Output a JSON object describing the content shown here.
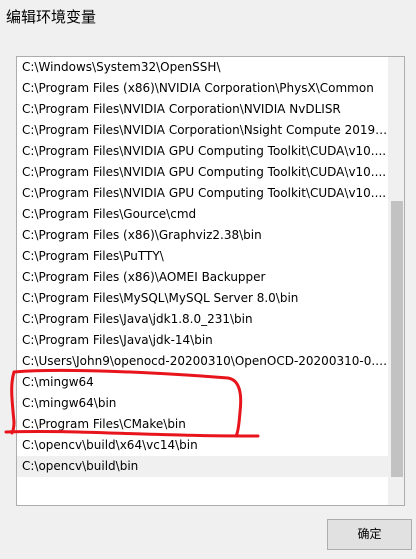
{
  "window": {
    "title": "编辑环境变量"
  },
  "path_list": {
    "items": [
      "C:\\Windows\\System32\\OpenSSH\\",
      "C:\\Program Files (x86)\\NVIDIA Corporation\\PhysX\\Common",
      "C:\\Program Files\\NVIDIA Corporation\\NVIDIA NvDLISR",
      "C:\\Program Files\\NVIDIA Corporation\\Nsight Compute 2019....",
      "C:\\Program Files\\NVIDIA GPU Computing Toolkit\\CUDA\\v10....",
      "C:\\Program Files\\NVIDIA GPU Computing Toolkit\\CUDA\\v10....",
      "C:\\Program Files\\NVIDIA GPU Computing Toolkit\\CUDA\\v10....",
      "C:\\Program Files\\Gource\\cmd",
      "C:\\Program Files (x86)\\Graphviz2.38\\bin",
      "C:\\Program Files\\PuTTY\\",
      "C:\\Program Files (x86)\\AOMEI Backupper",
      "C:\\Program Files\\MySQL\\MySQL Server 8.0\\bin",
      "C:\\Program Files\\Java\\jdk1.8.0_231\\bin",
      "C:\\Program Files\\Java\\jdk-14\\bin",
      "C:\\Users\\John9\\openocd-20200310\\OpenOCD-20200310-0.1....",
      "C:\\mingw64",
      "C:\\mingw64\\bin",
      "C:\\Program Files\\CMake\\bin",
      "C:\\opencv\\build\\x64\\vc14\\bin",
      "C:\\opencv\\build\\bin"
    ],
    "selected_item": "C:\\opencv\\build\\bin"
  },
  "buttons": {
    "ok_label": "确定"
  },
  "colors": {
    "annotation": "#e8141c",
    "selection": "#f0f0f0"
  }
}
